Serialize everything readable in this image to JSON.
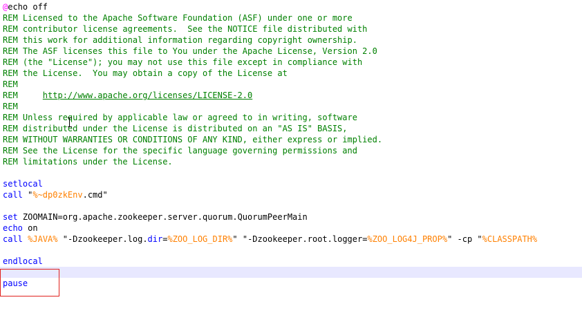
{
  "lines": {
    "l1_at": "@",
    "l1_rest": "echo off",
    "l2": "REM Licensed to the Apache Software Foundation (ASF) under one or more",
    "l3": "REM contributor license agreements.  See the NOTICE file distributed with",
    "l4": "REM this work for additional information regarding copyright ownership.",
    "l5": "REM The ASF licenses this file to You under the Apache License, Version 2.0",
    "l6": "REM (the \"License\"); you may not use this file except in compliance with",
    "l7": "REM the License.  You may obtain a copy of the License at",
    "l8": "REM",
    "l9_prefix": "REM     ",
    "l9_url": "http://www.apache.org/licenses/LICENSE-2.0",
    "l10": "REM",
    "l11": "REM Unless required by applicable law or agreed to in writing, software",
    "l12": "REM distributed under the License is distributed on an \"AS IS\" BASIS,",
    "l13": "REM WITHOUT WARRANTIES OR CONDITIONS OF ANY KIND, either express or implied.",
    "l14": "REM See the License for the specific language governing permissions and",
    "l15": "REM limitations under the License.",
    "l17": "setlocal",
    "l18_kw": "call",
    "l18_q1": " \"",
    "l18_var": "%~dp0zkEnv",
    "l18_rest": ".cmd\"",
    "l20_kw": "set",
    "l20_rest": " ZOOMAIN=org.apache.zookeeper.server.quorum.QuorumPeerMain",
    "l21_kw": "echo",
    "l21_rest": " on",
    "l22_kw": "call",
    "l22_sp": " ",
    "l22_java": "%JAVA%",
    "l22_a": " \"-Dzookeeper.log.",
    "l22_dir": "dir",
    "l22_eq": "=",
    "l22_logdir": "%ZOO_LOG_DIR%",
    "l22_b": "\" \"-Dzookeeper.root.logger=",
    "l22_log4j": "%ZOO_LOG4J_PROP%",
    "l22_c": "\" -cp \"",
    "l22_cp": "%CLASSPATH%",
    "l24": "endlocal",
    "l26": "pause"
  }
}
